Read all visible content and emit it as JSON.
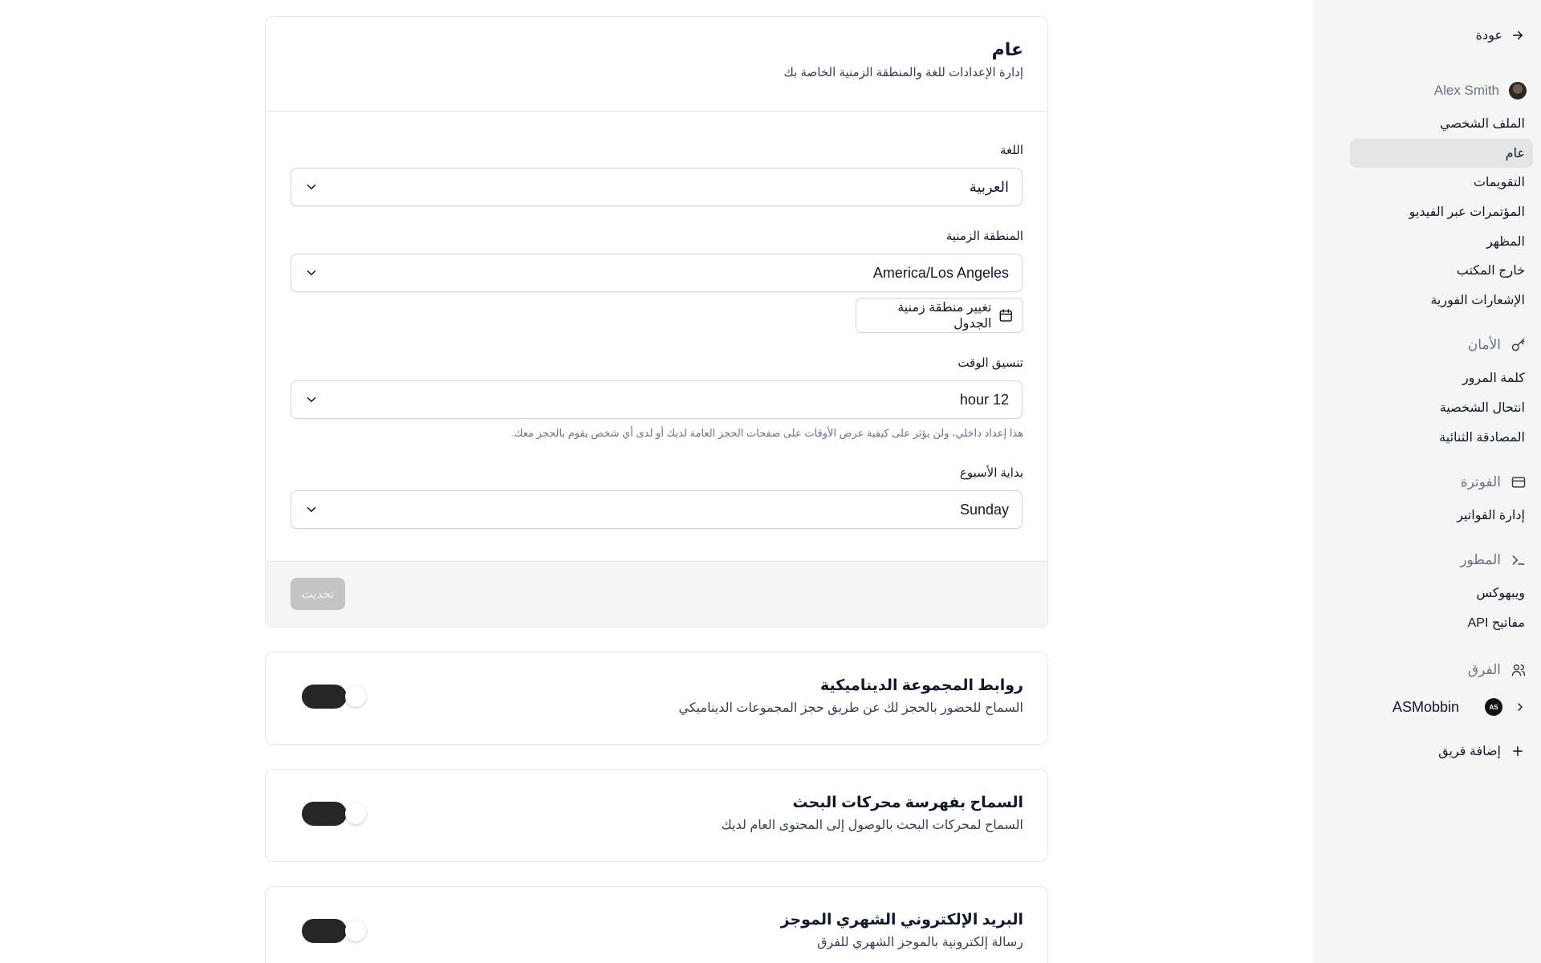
{
  "sidebar": {
    "back_label": "عودة",
    "user_name": "Alex Smith",
    "account_items": [
      "الملف الشخصي",
      "عام",
      "التقويمات",
      "المؤتمرات عبر الفيديو",
      "المظهر",
      "خارج المكتب",
      "الإشعارات الفورية"
    ],
    "active_item": "عام",
    "security_header": "الأمان",
    "security_items": [
      "كلمة المرور",
      "انتحال الشخصية",
      "المصادقة الثنائية"
    ],
    "billing_header": "الفوترة",
    "billing_items": [
      "إدارة الفواتير"
    ],
    "developer_header": "المطور",
    "developer_items": [
      "ويبهوكس",
      "مفاتيح API"
    ],
    "teams_header": "الفرق",
    "team_name": "ASMobbin",
    "team_initials": "AS",
    "add_team_label": "إضافة فريق"
  },
  "general": {
    "title": "عام",
    "subtitle": "إدارة الإعدادات للغة والمنطقة الزمنية الخاصة بك",
    "language_label": "اللغة",
    "language_value": "العربية",
    "timezone_label": "المنطقة الزمنية",
    "timezone_value": "America/Los Angeles",
    "schedule_tz_button": "تغيير منطقة زمنية الجدول",
    "time_format_label": "تنسيق الوقت",
    "time_format_value": "12 hour",
    "time_format_hint": "هذا إعداد داخلي، ولن يؤثر على كيفية عرض الأوقات على صفحات الحجز العامة لديك أو لدى أي شخص يقوم بالحجز معك.",
    "week_start_label": "بداية الأسبوع",
    "week_start_value": "Sunday",
    "update_button": "تحديث"
  },
  "toggles": [
    {
      "title": "روابط المجموعة الديناميكية",
      "subtitle": "السماح للحضور بالحجز لك عن طريق حجز المجموعات الديناميكي",
      "enabled": true
    },
    {
      "title": "السماح بفهرسة محركات البحث",
      "subtitle": "السماح لمحركات البحث بالوصول إلى المحتوى العام لديك",
      "enabled": true
    },
    {
      "title": "البريد الإلكتروني الشهري الموجز",
      "subtitle": "رسالة إلكترونية بالموجز الشهري للفرق",
      "enabled": true
    }
  ],
  "colors": {
    "toggle_on": "#262626",
    "sidebar_bg": "#f5f5f5",
    "active_item_bg": "#e5e5e5"
  }
}
